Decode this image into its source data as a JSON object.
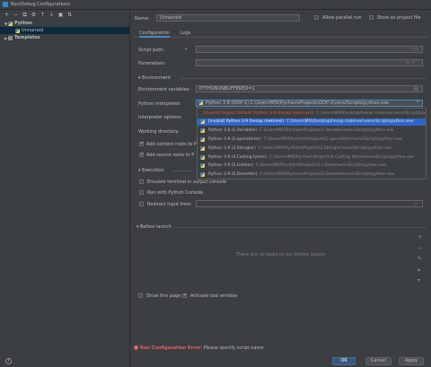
{
  "window": {
    "title": "Run/Debug Configurations"
  },
  "left_toolbar": {
    "add": "+",
    "remove": "−",
    "copy": "⧉",
    "settings": "⚙",
    "up": "↑",
    "down": "↓",
    "folder": "▣",
    "sort": "⇅"
  },
  "tree": {
    "python_label": "Python",
    "unnamed_label": "Unnamed",
    "templates_label": "Templates"
  },
  "header": {
    "name_label": "Name:",
    "name_value": "Unnamed",
    "allow_parallel_label": "Allow parallel run",
    "store_as_file_label": "Store as project file"
  },
  "tabs": [
    "Configuration",
    "Logs"
  ],
  "config": {
    "script_path_label": "Script path:",
    "parameters_label": "Parameters:",
    "environment_section": "Environment",
    "env_vars_label": "Environment variables:",
    "env_vars_value": "PYTHONUNBUFFERED=1",
    "interpreter_label": "Python interpreter:",
    "interpreter_value": "Python 3.8 (OOP-1) C:\\Users\\MSI\\PycharmProjects\\OOP-1\\venv\\Scripts\\python.exe",
    "interp_options_label": "Interpreter options:",
    "working_dir_label": "Working directory:",
    "add_content_roots_label": "Add content roots to P",
    "add_source_roots_label": "Add source roots to P",
    "execution_section": "Execution",
    "emulate_terminal_label": "Emulate terminal in output console",
    "run_with_console_label": "Run with Python Console",
    "redirect_input_label": "Redirect input from:"
  },
  "interpreter_list": [
    {
      "name": "[invalid] Project Default (Python 3.9 (hesap makinesi))",
      "path": "C:\\Users\\MSI\\Desktop\\hesap makinesi\\venv\\Scripts\\python.exe",
      "invalid": true,
      "selected": false
    },
    {
      "name": "[invalid] Python 3.9 (hesap makinesi)",
      "path": "C:\\Users\\MSI\\Desktop\\hesap makinesi\\venv\\Scripts\\python.exe",
      "invalid": true,
      "selected": true
    },
    {
      "name": "Python 3.8 (1.Variables)",
      "path": "C:\\Users\\MSI\\PycharmProjects\\1.Variables\\venv\\Scripts\\python.exe",
      "invalid": false,
      "selected": false
    },
    {
      "name": "Python 3.9 (2.operatörler)",
      "path": "C:\\Users\\MSI\\PycharmProjects\\2.operatörler\\venv\\Scripts\\python.exe",
      "invalid": false,
      "selected": false
    },
    {
      "name": "Python 3.9 (3.Stringler)",
      "path": "C:\\Users\\MSI\\PycharmProjects\\3.Stringler\\venv\\Scripts\\python.exe",
      "invalid": false,
      "selected": false
    },
    {
      "name": "Python 3.9 (4.Casting İşlemi)",
      "path": "C:\\Users\\MSI\\PycharmProjects\\4.Casting İşlemi\\venv\\Scripts\\python.exe",
      "invalid": false,
      "selected": false
    },
    {
      "name": "Python 3.9 (5.Listeler)",
      "path": "C:\\Users\\MSI\\PycharmProjects\\5.Listeler\\venv\\Scripts\\python.exe",
      "invalid": false,
      "selected": false
    },
    {
      "name": "Python 3.9 (6.Demetler)",
      "path": "C:\\Users\\MSI\\PycharmProjects\\6.Demetler\\venv\\Scripts\\python.exe",
      "invalid": false,
      "selected": false
    }
  ],
  "before_launch": {
    "section_label": "Before launch",
    "empty_text": "There are no tasks to run before launch"
  },
  "footer": {
    "show_page_label": "Show this page",
    "activate_tool_label": "Activate tool window",
    "error_title": "Run Configuration Error:",
    "error_text": "Please specify script name",
    "ok_label": "OK",
    "cancel_label": "Cancel",
    "apply_label": "Apply",
    "help_label": "?"
  },
  "colors": {
    "accent": "#2f65ca",
    "error": "#e06060",
    "background": "#3c3f41"
  }
}
